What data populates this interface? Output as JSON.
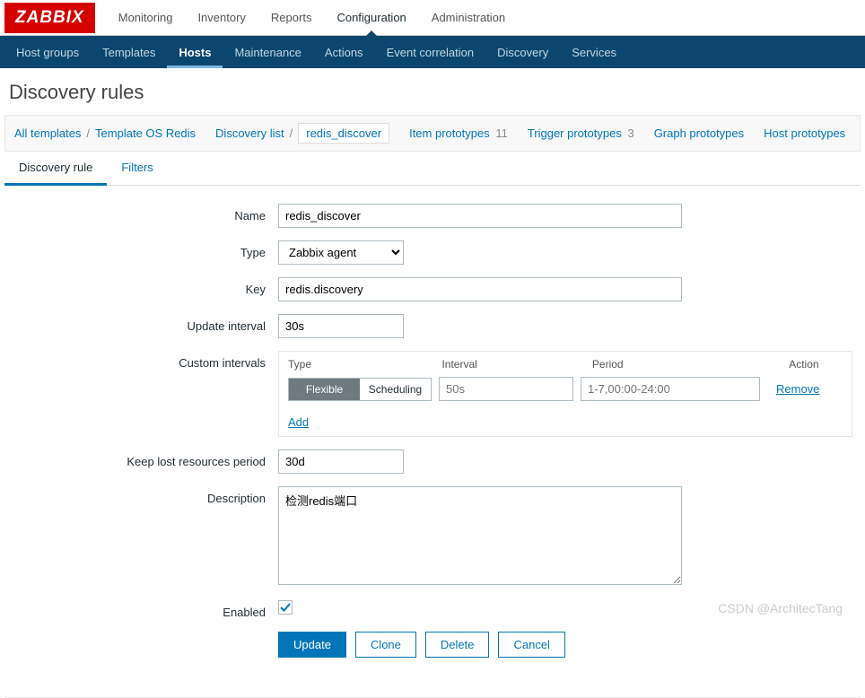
{
  "logo": "ZABBIX",
  "topNav": {
    "items": [
      "Monitoring",
      "Inventory",
      "Reports",
      "Configuration",
      "Administration"
    ],
    "active": "Configuration"
  },
  "subNav": {
    "items": [
      "Host groups",
      "Templates",
      "Hosts",
      "Maintenance",
      "Actions",
      "Event correlation",
      "Discovery",
      "Services"
    ],
    "active": "Hosts"
  },
  "pageTitle": "Discovery rules",
  "breadcrumb": {
    "allTemplates": "All templates",
    "template": "Template OS Redis",
    "discoveryList": "Discovery list",
    "current": "redis_discover",
    "itemProto": "Item prototypes",
    "itemProtoCount": "11",
    "triggerProto": "Trigger prototypes",
    "triggerProtoCount": "3",
    "graphProto": "Graph prototypes",
    "hostProto": "Host prototypes"
  },
  "tabs": {
    "discoveryRule": "Discovery rule",
    "filters": "Filters"
  },
  "form": {
    "labels": {
      "name": "Name",
      "type": "Type",
      "key": "Key",
      "updateInterval": "Update interval",
      "customIntervals": "Custom intervals",
      "keepLost": "Keep lost resources period",
      "description": "Description",
      "enabled": "Enabled"
    },
    "values": {
      "name": "redis_discover",
      "type": "Zabbix agent",
      "key": "redis.discovery",
      "updateInterval": "30s",
      "keepLost": "30d",
      "description": "检测redis端口",
      "enabled": true
    },
    "customIntervals": {
      "headers": {
        "type": "Type",
        "interval": "Interval",
        "period": "Period",
        "action": "Action"
      },
      "toggle": {
        "flexible": "Flexible",
        "scheduling": "Scheduling"
      },
      "intervalPh": "50s",
      "periodPh": "1-7,00:00-24:00",
      "remove": "Remove",
      "add": "Add"
    },
    "buttons": {
      "update": "Update",
      "clone": "Clone",
      "delete": "Delete",
      "cancel": "Cancel"
    }
  },
  "watermark": "CSDN @ArchitecTang"
}
